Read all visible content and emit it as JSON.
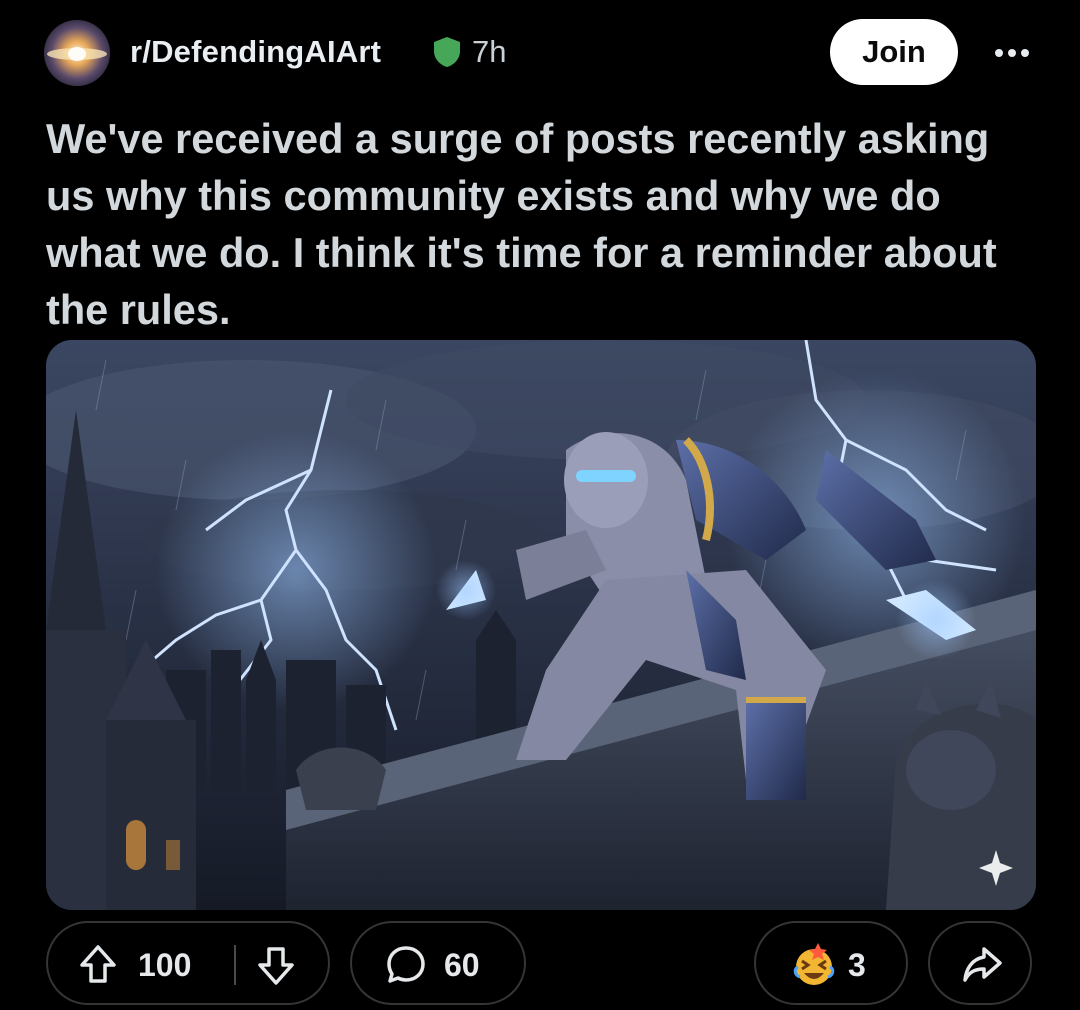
{
  "header": {
    "subreddit": "r/DefendingAIArt",
    "time_ago": "7h",
    "join_label": "Join",
    "mod_badge_color": "#46a758"
  },
  "post": {
    "title": "We've received a surge of posts recently asking us why this community exists and why we do what we do. I think it's time for a reminder about the rules."
  },
  "actions": {
    "upvotes": "100",
    "comments": "60",
    "awards": "3"
  },
  "icons": {
    "more": "more-horizontal-icon",
    "upvote": "upvote-arrow-icon",
    "downvote": "downvote-arrow-icon",
    "comment": "comment-bubble-icon",
    "award": "award-emoji-icon",
    "share": "share-arrow-icon",
    "ai_badge": "sparkle-icon"
  },
  "colors": {
    "background": "#000000",
    "title_text": "#d3d8dc",
    "pill_border": "#343536",
    "join_bg": "#ffffff"
  }
}
